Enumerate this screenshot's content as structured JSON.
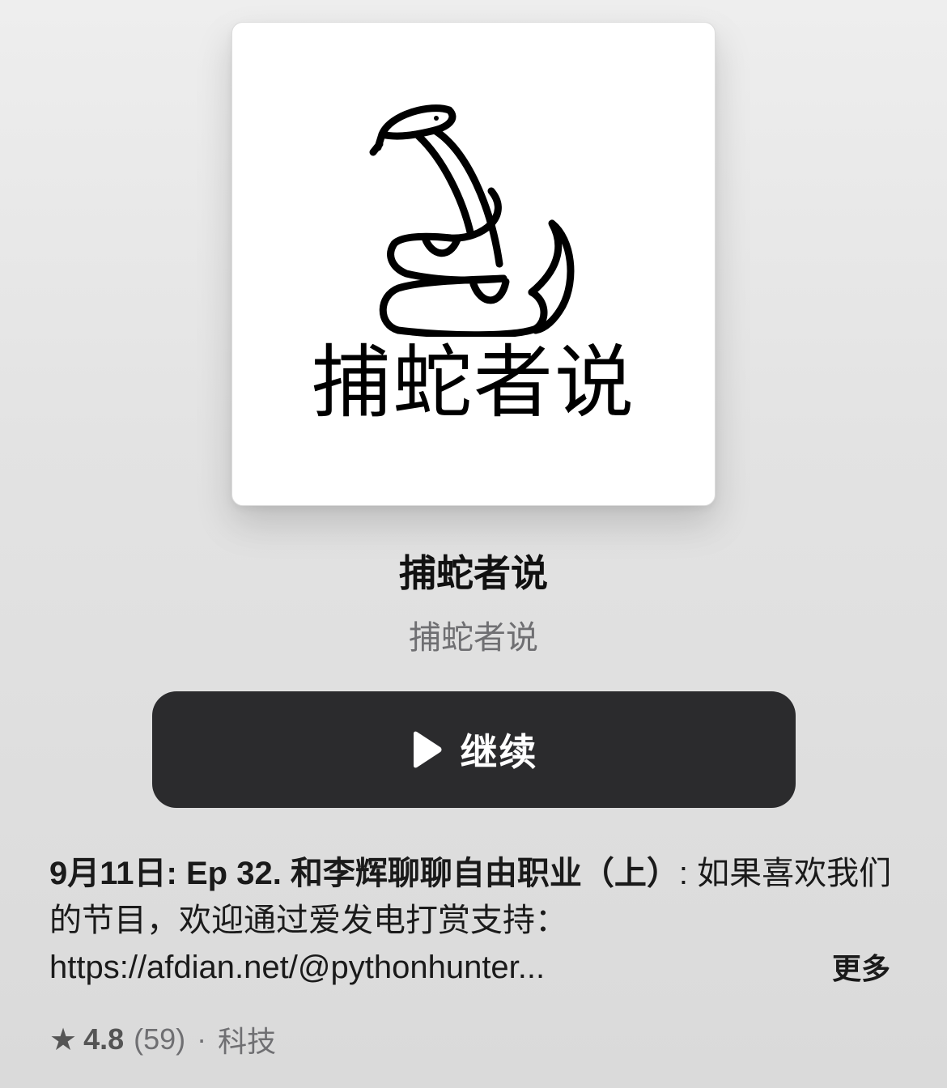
{
  "podcast": {
    "artwork_text": "捕蛇者说",
    "title": "捕蛇者说",
    "author": "捕蛇者说"
  },
  "actions": {
    "play_label": "继续"
  },
  "episode": {
    "date": "9月11日",
    "title": "Ep 32. 和李辉聊聊自由职业（上）",
    "summary": "如果喜欢我们的节目，欢迎通过爱发电打赏支持：https://afdian.net/@pythonhunter...",
    "more_label": "更多"
  },
  "meta": {
    "rating": "4.8",
    "rating_count": "(59)",
    "separator": "·",
    "category": "科技"
  },
  "icons": {
    "play": "play-icon",
    "star": "star-icon"
  }
}
